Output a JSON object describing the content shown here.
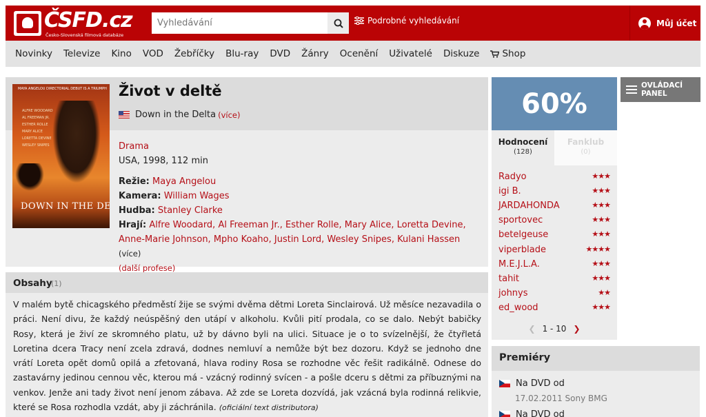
{
  "header": {
    "logo_text": "ČSFD.cz",
    "logo_sub": "Česko-Slovenská filmová databáze",
    "search_placeholder": "Vyhledávání",
    "advanced_search": "Podrobné vyhledávání",
    "account": "Můj účet"
  },
  "nav": [
    "Novinky",
    "Televize",
    "Kino",
    "VOD",
    "Žebříčky",
    "Blu-ray",
    "DVD",
    "Žánry",
    "Ocenění",
    "Uživatelé",
    "Diskuze",
    "Shop"
  ],
  "poster": {
    "top": "MAYA ANGELOU DIRECTORIAL DEBUT IS A TRIUMPH",
    "cast": [
      "ALFRE WOODARD",
      "AL FREEMAN JR.",
      "ESTHER ROLLE",
      "MARY ALICE",
      "LORETTA DEVINE",
      "WESLEY SNIPES"
    ],
    "title": "DOWN IN THE DELTA"
  },
  "film": {
    "title": "Život v deltě",
    "original_title": "Down in the Delta",
    "more": "(více)",
    "genre": "Drama",
    "origin": "USA, 1998, 112 min",
    "director_label": "Režie:",
    "director": "Maya Angelou",
    "camera_label": "Kamera:",
    "camera": "William Wages",
    "music_label": "Hudba:",
    "music": "Stanley Clarke",
    "cast_label": "Hrají:",
    "cast": "Alfre Woodard, Al Freeman Jr., Esther Rolle, Mary Alice, Loretta Devine, Anne-Marie Johnson, Mpho Koaho, Justin Lord, Wesley Snipes, Kulani Hassen",
    "cast_more": "(více)",
    "more_professions": "(další profese)"
  },
  "summary": {
    "title": "Obsahy",
    "count": "(1)",
    "text": "V malém bytě chicagského předměstí žije se svými dvěma dětmi Loreta Sinclairová. Už měsíce nezavadila o práci. Není divu, že každý neúspěšný den utápí v alkoholu. Kvůli pití prodala, co se dalo. Nebýt babičky Rosy, která je živí ze skromného platu, už by dávno byli na ulici. Situace je o to svízelnější, že čtyřletá Loretina dcera Tracy není zcela zdravá, dodnes nemluví a nemůže být bez dozoru. Když se jednoho dne vrátí Loreta opět domů opilá a zfetovaná, hlava rodiny Rosa se rozhodne věc řešit radikálně. Odnese do zastavárny jedinou cennou věc, kterou má - vzácný rodinný svícen - a pošle dceru s dětmi za příbuznými na venkov. Jenže ani tady život není jenom zábava. Až zde se Loreta dozvídá, jak vzácná byla rodinná relikvie, které se Rosa rozhodla vzdát, aby ji záchránila.",
    "source": "(oficiální text distributora)"
  },
  "rating": {
    "percent": "60%",
    "tab_ratings": "Hodnocení",
    "tab_ratings_count": "(128)",
    "tab_fanclub": "Fanklub",
    "tab_fanclub_count": "(0)",
    "users": [
      {
        "name": "Radyo",
        "stars": "★★★"
      },
      {
        "name": "igi B.",
        "stars": "★★★"
      },
      {
        "name": "JARDAHONDA",
        "stars": "★★★"
      },
      {
        "name": "sportovec",
        "stars": "★★★"
      },
      {
        "name": "betelgeuse",
        "stars": "★★★"
      },
      {
        "name": "viperblade",
        "stars": "★★★★"
      },
      {
        "name": "M.E.J.L.A.",
        "stars": "★★★"
      },
      {
        "name": "tahit",
        "stars": "★★★"
      },
      {
        "name": "johnys",
        "stars": "★★"
      },
      {
        "name": "ed_wood",
        "stars": "★★★"
      }
    ],
    "pager": "1 - 10"
  },
  "control_panel": {
    "line1": "OVLÁDACÍ",
    "line2": "PANEL"
  },
  "premieres": {
    "title": "Premiéry",
    "row1": "Na DVD od",
    "row1_sub": "17.02.2011 Sony BMG",
    "row2": "Na DVD od"
  }
}
